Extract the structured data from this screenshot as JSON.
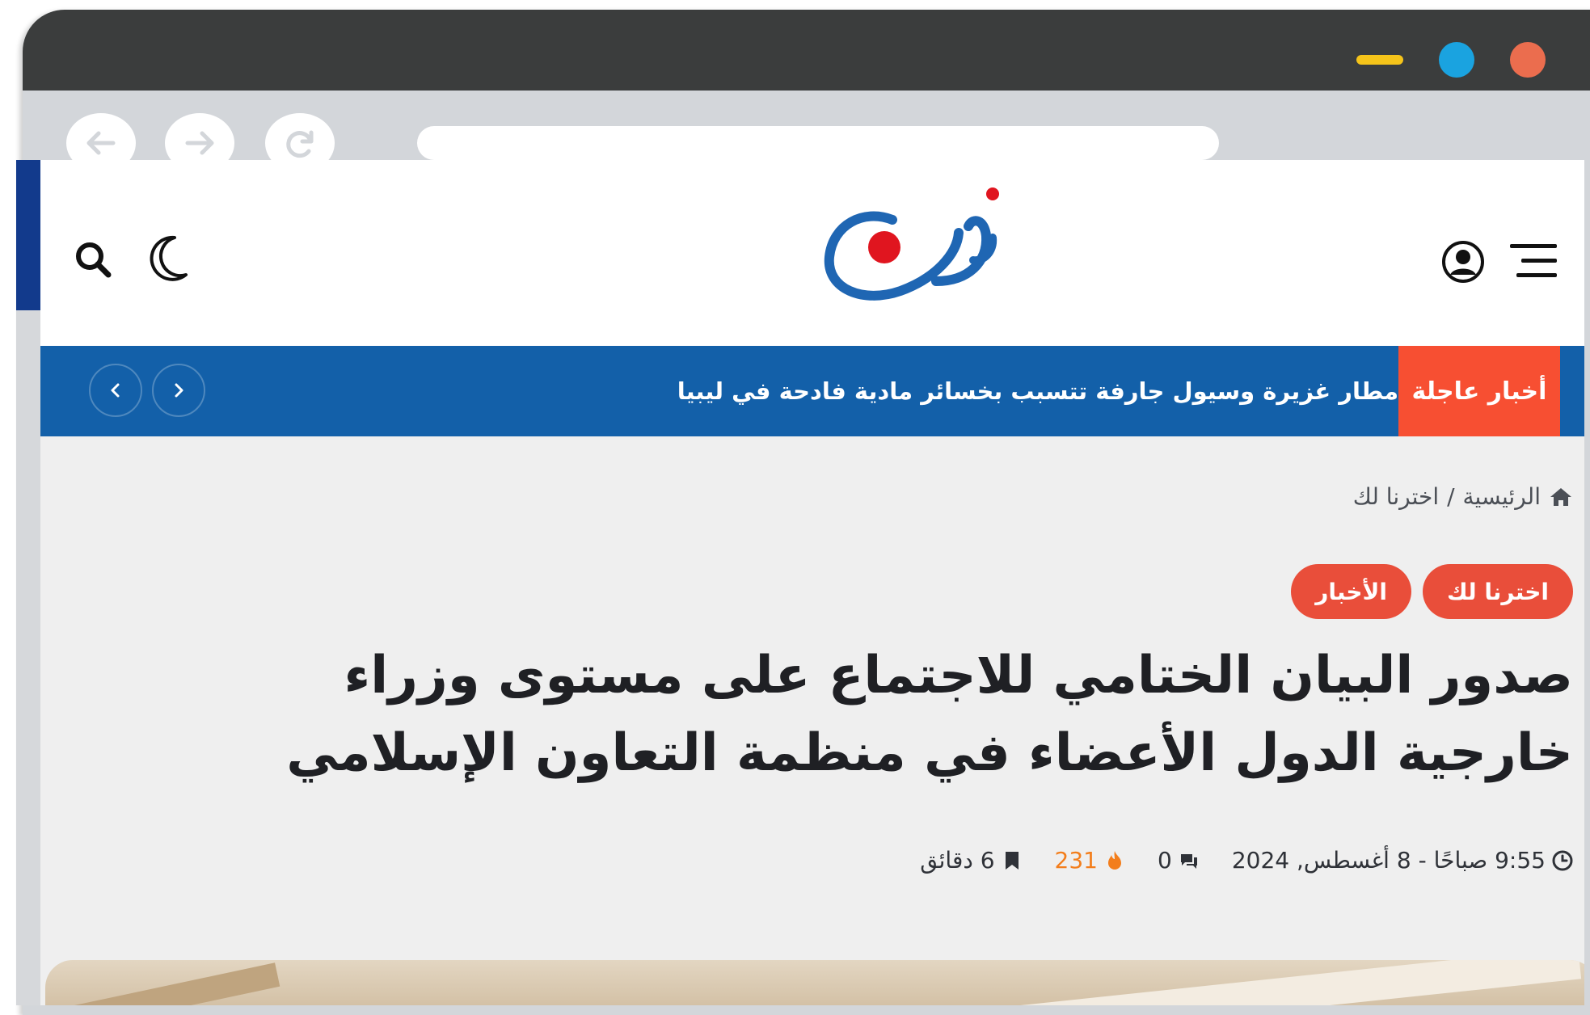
{
  "ticker": {
    "label": "أخبار عاجلة",
    "headline": "أمطار غزيرة وسيول جارفة تتسبب بخسائر مادية فادحة في ليبيا"
  },
  "breadcrumb": {
    "home": "الرئيسية",
    "separator": "/",
    "current": "اخترنا لك"
  },
  "tags": [
    "اخترنا لك",
    "الأخبار"
  ],
  "article": {
    "title": "صدور البيان الختامي للاجتماع على مستوى وزراء خارجية الدول الأعضاء في منظمة التعاون الإسلامي"
  },
  "meta": {
    "datetime": "9:55 صباحًا - 8 أغسطس, 2024",
    "comments": "0",
    "views": "231",
    "read_time": "6 دقائق"
  },
  "icons": {
    "search": "search-icon",
    "theme": "moon-icon",
    "user": "user-icon",
    "menu": "menu-icon",
    "clock": "clock-icon",
    "comments": "comments-icon",
    "views": "fire-icon",
    "reading": "bookmark-icon",
    "home": "home-icon"
  },
  "colors": {
    "ticker_bg": "#1360a9",
    "ticker_label_bg": "#f74f32",
    "tag_bg": "#e94e3a",
    "views": "#f37e1c",
    "logo_blue": "#1f66b3",
    "logo_red": "#e0151f"
  }
}
